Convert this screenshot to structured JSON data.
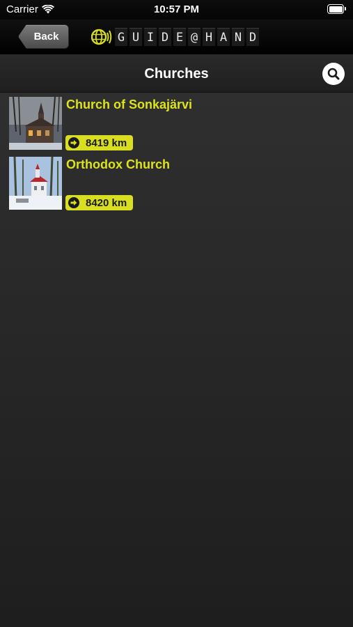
{
  "status_bar": {
    "carrier": "Carrier",
    "time": "10:57 PM",
    "icons": [
      "wifi-icon",
      "battery-icon"
    ]
  },
  "nav": {
    "back_label": "Back",
    "brand_letters": [
      "G",
      "U",
      "I",
      "D",
      "E",
      "@",
      "H",
      "A",
      "N",
      "D"
    ],
    "brand_icon": "globe-sound-icon"
  },
  "header": {
    "title": "Churches",
    "search_icon": "search-icon"
  },
  "items": [
    {
      "name": "Church of Sonkajärvi",
      "distance": "8419 km",
      "icon": "arrow-right-circle-icon"
    },
    {
      "name": "Orthodox Church",
      "distance": "8420 km",
      "icon": "arrow-right-circle-icon"
    }
  ],
  "colors": {
    "accent": "#dde21f",
    "badge": "#d9de20",
    "background": "#2a2a2a"
  }
}
